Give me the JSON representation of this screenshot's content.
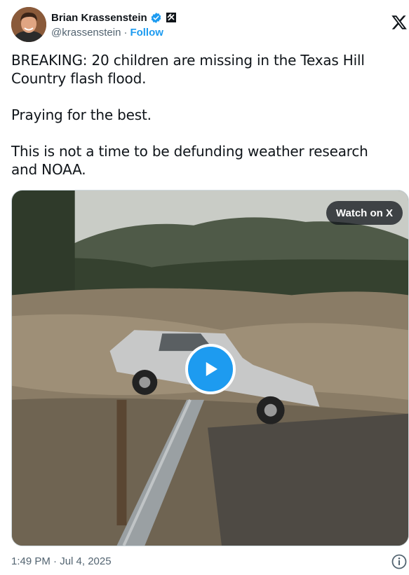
{
  "author": {
    "display_name": "Brian Krassenstein",
    "handle": "@krassenstein",
    "separator": "·",
    "follow_label": "Follow"
  },
  "tweet": {
    "paragraphs": [
      "BREAKING: 20 children are missing in the Texas Hill Country flash flood.",
      "Praying for the best.",
      "This is not a time to be defunding weather research and NOAA."
    ]
  },
  "media": {
    "watch_label": "Watch on X",
    "play_icon": "play-icon"
  },
  "footer": {
    "timestamp": "1:49 PM · Jul 4, 2025",
    "info_icon": "info-icon"
  },
  "colors": {
    "accent": "#1d9bf0",
    "text": "#0f1419",
    "secondary": "#536471"
  }
}
